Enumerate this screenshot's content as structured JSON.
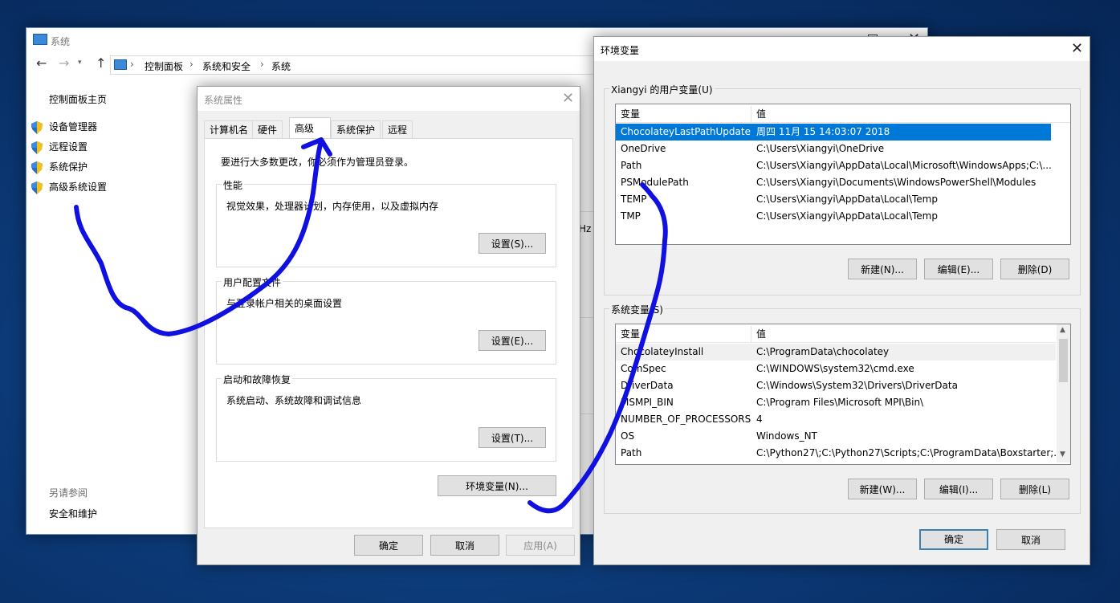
{
  "colors": {
    "accent": "#0078d7",
    "desktop": "#0c3a78",
    "annotation": "#1010e0"
  },
  "system_window": {
    "title": "系统",
    "nav": {
      "back_icon": "back-arrow-icon",
      "forward_icon": "forward-arrow-icon",
      "up_icon": "up-arrow-icon"
    },
    "breadcrumb": [
      "控制面板",
      "系统和安全",
      "系统"
    ],
    "sidebar_home": "控制面板主页",
    "sidebar_items": [
      "设备管理器",
      "远程设置",
      "系统保护",
      "高级系统设置"
    ],
    "see_also_title": "另请参阅",
    "see_also_items": [
      "安全和维护"
    ],
    "clipped_text": "Hz"
  },
  "sysprops": {
    "title": "系统属性",
    "tabs": [
      "计算机名",
      "硬件",
      "高级",
      "系统保护",
      "远程"
    ],
    "admin_note": "要进行大多数更改，你必须作为管理员登录。",
    "perf": {
      "label": "性能",
      "desc": "视觉效果，处理器计划，内存使用，以及虚拟内存",
      "button": "设置(S)..."
    },
    "profile": {
      "label": "用户配置文件",
      "desc": "与登录帐户相关的桌面设置",
      "button": "设置(E)..."
    },
    "startup": {
      "label": "启动和故障恢复",
      "desc": "系统启动、系统故障和调试信息",
      "button": "设置(T)..."
    },
    "env_button": "环境变量(N)...",
    "ok": "确定",
    "cancel": "取消",
    "apply": "应用(A)"
  },
  "envvars": {
    "title": "环境变量",
    "user_section": "Xiangyi 的用户变量(U)",
    "col_var": "变量",
    "col_val": "值",
    "user_vars": [
      {
        "name": "ChocolateyLastPathUpdate",
        "value": "周四 11月 15 14:03:07 2018"
      },
      {
        "name": "OneDrive",
        "value": "C:\\Users\\Xiangyi\\OneDrive"
      },
      {
        "name": "Path",
        "value": "C:\\Users\\Xiangyi\\AppData\\Local\\Microsoft\\WindowsApps;C:\\..."
      },
      {
        "name": "PSModulePath",
        "value": "C:\\Users\\Xiangyi\\Documents\\WindowsPowerShell\\Modules"
      },
      {
        "name": "TEMP",
        "value": "C:\\Users\\Xiangyi\\AppData\\Local\\Temp"
      },
      {
        "name": "TMP",
        "value": "C:\\Users\\Xiangyi\\AppData\\Local\\Temp"
      }
    ],
    "user_buttons": [
      "新建(N)...",
      "编辑(E)...",
      "删除(D)"
    ],
    "sys_section": "系统变量(S)",
    "sys_vars": [
      {
        "name": "ChocolateyInstall",
        "value": "C:\\ProgramData\\chocolatey"
      },
      {
        "name": "ComSpec",
        "value": "C:\\WINDOWS\\system32\\cmd.exe"
      },
      {
        "name": "DriverData",
        "value": "C:\\Windows\\System32\\Drivers\\DriverData"
      },
      {
        "name": "MSMPI_BIN",
        "value": "C:\\Program Files\\Microsoft MPI\\Bin\\"
      },
      {
        "name": "NUMBER_OF_PROCESSORS",
        "value": "4"
      },
      {
        "name": "OS",
        "value": "Windows_NT"
      },
      {
        "name": "Path",
        "value": "C:\\Python27\\;C:\\Python27\\Scripts;C:\\ProgramData\\Boxstarter;..."
      }
    ],
    "sys_buttons": [
      "新建(W)...",
      "编辑(I)...",
      "删除(L)"
    ],
    "ok": "确定",
    "cancel": "取消"
  }
}
